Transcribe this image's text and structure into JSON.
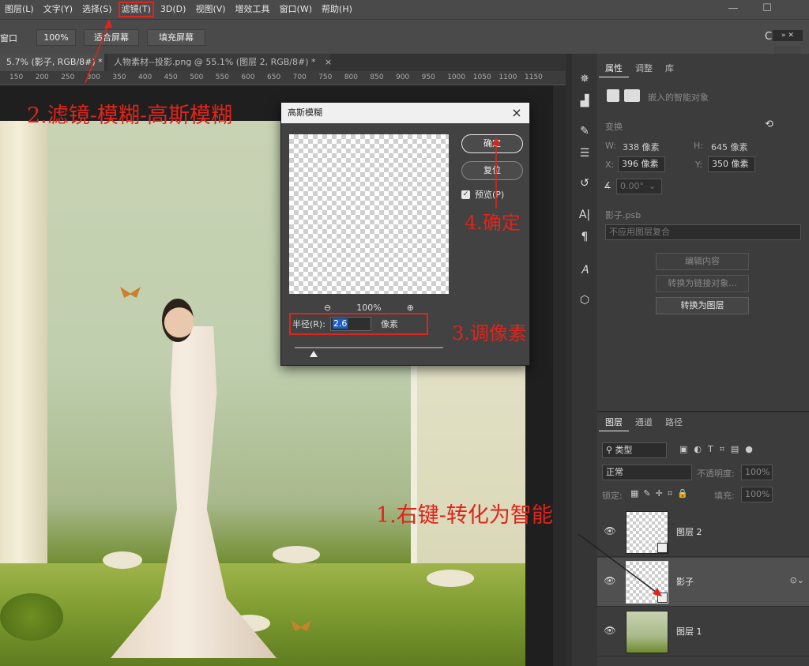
{
  "menu": [
    "图层(L)",
    "文字(Y)",
    "选择(S)",
    "滤镜(T)",
    "3D(D)",
    "视图(V)",
    "增效工具",
    "窗口(W)",
    "帮助(H)"
  ],
  "window_controls": {
    "minimize": "—",
    "maximize": "☐"
  },
  "options": {
    "left_label": "窗口",
    "zoom": "100%",
    "fit_screen": "适合屏幕",
    "fill_screen": "填充屏幕"
  },
  "tabs": [
    "5.7% (影子, RGB/8#) *",
    "人物素材--投影.png @ 55.1% (图层 2, RGB/8#) *"
  ],
  "tab_close": "×",
  "ruler": [
    "150",
    "200",
    "250",
    "300",
    "350",
    "400",
    "450",
    "500",
    "550",
    "600",
    "650",
    "700",
    "750",
    "800",
    "850",
    "900",
    "950",
    "1000",
    "1050",
    "1100",
    "1150"
  ],
  "dialog": {
    "title": "高斯模糊",
    "close": "×",
    "ok": "确定",
    "reset": "复位",
    "preview_label": "预览(P)",
    "zoom": "100%",
    "radius_label": "半径(R):",
    "radius_value": "2.6",
    "radius_unit": "像素"
  },
  "annotations": {
    "step1": "1.右键-转化为智能对象",
    "step2": "2.滤镜-模糊-高斯模糊",
    "step3": "3.调像素",
    "step4": "4.确定"
  },
  "properties": {
    "tabs": [
      "属性",
      "调整",
      "库"
    ],
    "smart_object_label": "嵌入的智能对象",
    "transform_label": "变换",
    "w_label": "W:",
    "w_value": "338 像素",
    "h_label": "H:",
    "h_value": "645 像素",
    "x_label": "X:",
    "x_value": "396 像素",
    "y_label": "Y:",
    "y_value": "350 像素",
    "angle_value": "0.00°",
    "source_file": "影子.psb",
    "comp_select": "不应用图层复合",
    "edit_contents": "编辑内容",
    "convert_linked": "转换为链接对象...",
    "convert_layer": "转换为图层"
  },
  "layers_panel": {
    "tabs": [
      "图层",
      "通道",
      "路径"
    ],
    "kind_filter": "类型",
    "blend_mode": "正常",
    "opacity_label": "不透明度:",
    "opacity_value": "100%",
    "lock_label": "锁定:",
    "fill_label": "填充:",
    "fill_value": "100%",
    "layers": [
      {
        "name": "图层 2"
      },
      {
        "name": "影子"
      },
      {
        "name": "图层 1"
      }
    ]
  }
}
